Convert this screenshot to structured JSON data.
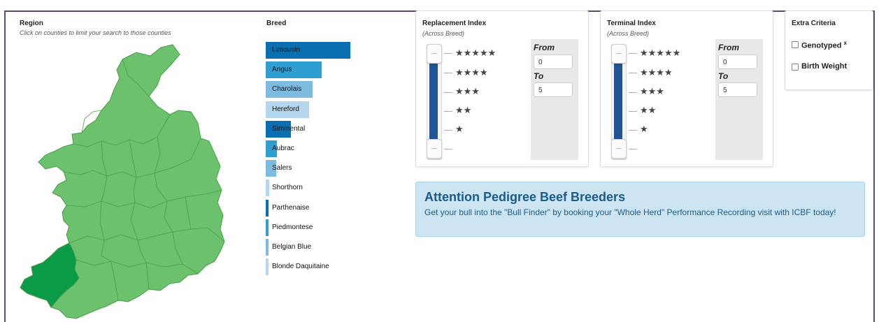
{
  "region": {
    "title": "Region",
    "subtitle": "Click on counties to limit your search to those counties"
  },
  "breed": {
    "title": "Breed",
    "items": [
      {
        "label": "Limousin",
        "share": 1.0,
        "color": "#0a6fb0"
      },
      {
        "label": "Angus",
        "share": 0.66,
        "color": "#2f9fd2"
      },
      {
        "label": "Charolais",
        "share": 0.55,
        "color": "#7dbbe0"
      },
      {
        "label": "Hereford",
        "share": 0.51,
        "color": "#b4d6ee"
      },
      {
        "label": "Simmental",
        "share": 0.3,
        "color": "#0a6fb0"
      },
      {
        "label": "Aubrac",
        "share": 0.13,
        "color": "#2f9fd2"
      },
      {
        "label": "Salers",
        "share": 0.12,
        "color": "#7dbbe0"
      },
      {
        "label": "Shorthorn",
        "share": 0.04,
        "color": "#b4d6ee"
      },
      {
        "label": "Parthenaise",
        "share": 0.03,
        "color": "#0a6fb0"
      },
      {
        "label": "Piedmontese",
        "share": 0.03,
        "color": "#2f9fd2"
      },
      {
        "label": "Belgian Blue",
        "share": 0.03,
        "color": "#7dbbe0"
      },
      {
        "label": "Blonde Daquitaine",
        "share": 0.03,
        "color": "#b4d6ee"
      }
    ]
  },
  "replacement": {
    "title": "Replacement Index",
    "subtitle": "(Across Breed)",
    "stars": [
      "★★★★★",
      "★★★★",
      "★★★",
      "★★",
      "★"
    ],
    "from_label": "From",
    "from_value": "0",
    "to_label": "To",
    "to_value": "5"
  },
  "terminal": {
    "title": "Terminal Index",
    "subtitle": "(Across Breed)",
    "stars": [
      "★★★★★",
      "★★★★",
      "★★★",
      "★★",
      "★"
    ],
    "from_label": "From",
    "from_value": "0",
    "to_label": "To",
    "to_value": "5"
  },
  "extra": {
    "title": "Extra Criteria",
    "genotyped": "Genotyped",
    "genotyped_mark": "x",
    "birth_weight": "Birth Weight"
  },
  "alert": {
    "title": "Attention Pedigree Beef Breeders",
    "body": "Get your bull into the \"Bull Finder\" by booking your \"Whole Herd\" Performance Recording visit with ICBF today!"
  },
  "colors": {
    "map_fill": "#6cc16c",
    "map_selected": "#0b9a45",
    "map_border": "#4a9d4a",
    "slider_fill": "#1f5597"
  }
}
